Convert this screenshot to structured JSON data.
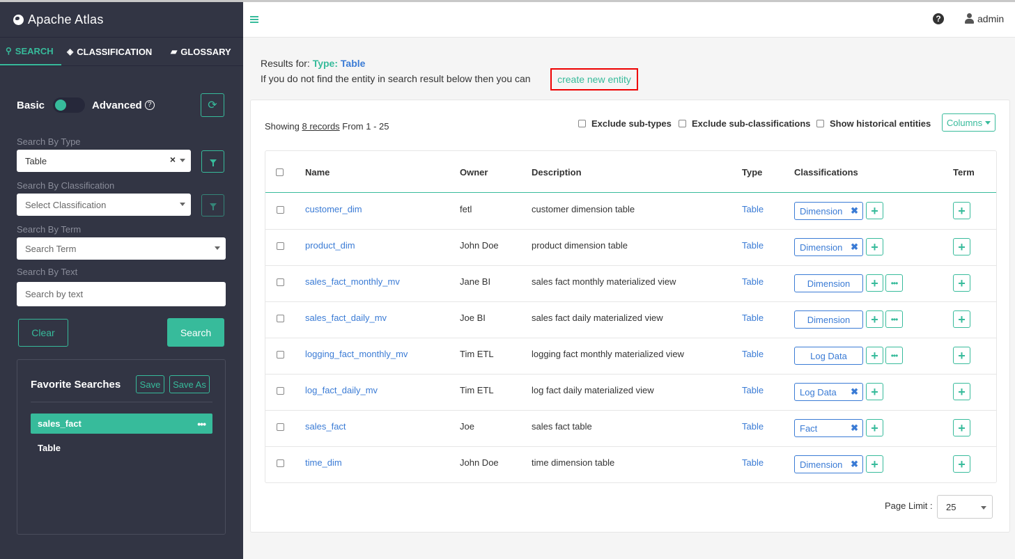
{
  "app": {
    "title": "Apache Atlas"
  },
  "tabs": [
    {
      "label": "SEARCH",
      "active": true
    },
    {
      "label": "CLASSIFICATION",
      "active": false
    },
    {
      "label": "GLOSSARY",
      "active": false
    }
  ],
  "search": {
    "basic_label": "Basic",
    "advanced_label": "Advanced",
    "by_type_label": "Search By Type",
    "by_type_value": "Table",
    "by_classification_label": "Search By Classification",
    "by_classification_placeholder": "Select Classification",
    "by_term_label": "Search By Term",
    "by_term_placeholder": "Search Term",
    "by_text_label": "Search By Text",
    "by_text_placeholder": "Search by text",
    "clear_label": "Clear",
    "search_label": "Search"
  },
  "favorites": {
    "title": "Favorite Searches",
    "save_label": "Save",
    "save_as_label": "Save As",
    "items": [
      {
        "label": "sales_fact",
        "active": true
      },
      {
        "label": "Table",
        "active": false
      }
    ]
  },
  "header": {
    "user": "admin"
  },
  "results": {
    "prefix": "Results for: ",
    "type_label": "Type:",
    "type_value": "Table",
    "info_text": "If you do not find the entity in search result below then you can",
    "create_link": "create new entity",
    "showing_prefix": "Showing ",
    "showing_count": "8 records",
    "showing_suffix": " From 1 - 25",
    "exclude_subtypes": "Exclude sub-types",
    "exclude_subclassifications": "Exclude sub-classifications",
    "show_historical": "Show historical entities",
    "columns_label": "Columns"
  },
  "table": {
    "headers": {
      "name": "Name",
      "owner": "Owner",
      "description": "Description",
      "type": "Type",
      "classifications": "Classifications",
      "term": "Term"
    },
    "rows": [
      {
        "name": "customer_dim",
        "owner": "fetl",
        "description": "customer dimension table",
        "type": "Table",
        "classification": "Dimension",
        "removable": true,
        "more": false
      },
      {
        "name": "product_dim",
        "owner": "John Doe",
        "description": "product dimension table",
        "type": "Table",
        "classification": "Dimension",
        "removable": true,
        "more": false
      },
      {
        "name": "sales_fact_monthly_mv",
        "owner": "Jane BI",
        "description": "sales fact monthly materialized view",
        "type": "Table",
        "classification": "Dimension",
        "removable": false,
        "more": true
      },
      {
        "name": "sales_fact_daily_mv",
        "owner": "Joe BI",
        "description": "sales fact daily materialized view",
        "type": "Table",
        "classification": "Dimension",
        "removable": false,
        "more": true
      },
      {
        "name": "logging_fact_monthly_mv",
        "owner": "Tim ETL",
        "description": "logging fact monthly materialized view",
        "type": "Table",
        "classification": "Log Data",
        "removable": false,
        "more": true
      },
      {
        "name": "log_fact_daily_mv",
        "owner": "Tim ETL",
        "description": "log fact daily materialized view",
        "type": "Table",
        "classification": "Log Data",
        "removable": true,
        "more": false
      },
      {
        "name": "sales_fact",
        "owner": "Joe",
        "description": "sales fact table",
        "type": "Table",
        "classification": "Fact",
        "removable": true,
        "more": false
      },
      {
        "name": "time_dim",
        "owner": "John Doe",
        "description": "time dimension table",
        "type": "Table",
        "classification": "Dimension",
        "removable": true,
        "more": false
      }
    ]
  },
  "pagination": {
    "label": "Page Limit :",
    "value": "25"
  },
  "colors": {
    "accent": "#37bb9b",
    "link": "#3a7bd5",
    "sidebar": "#323544",
    "highlight": "#ee0000"
  }
}
